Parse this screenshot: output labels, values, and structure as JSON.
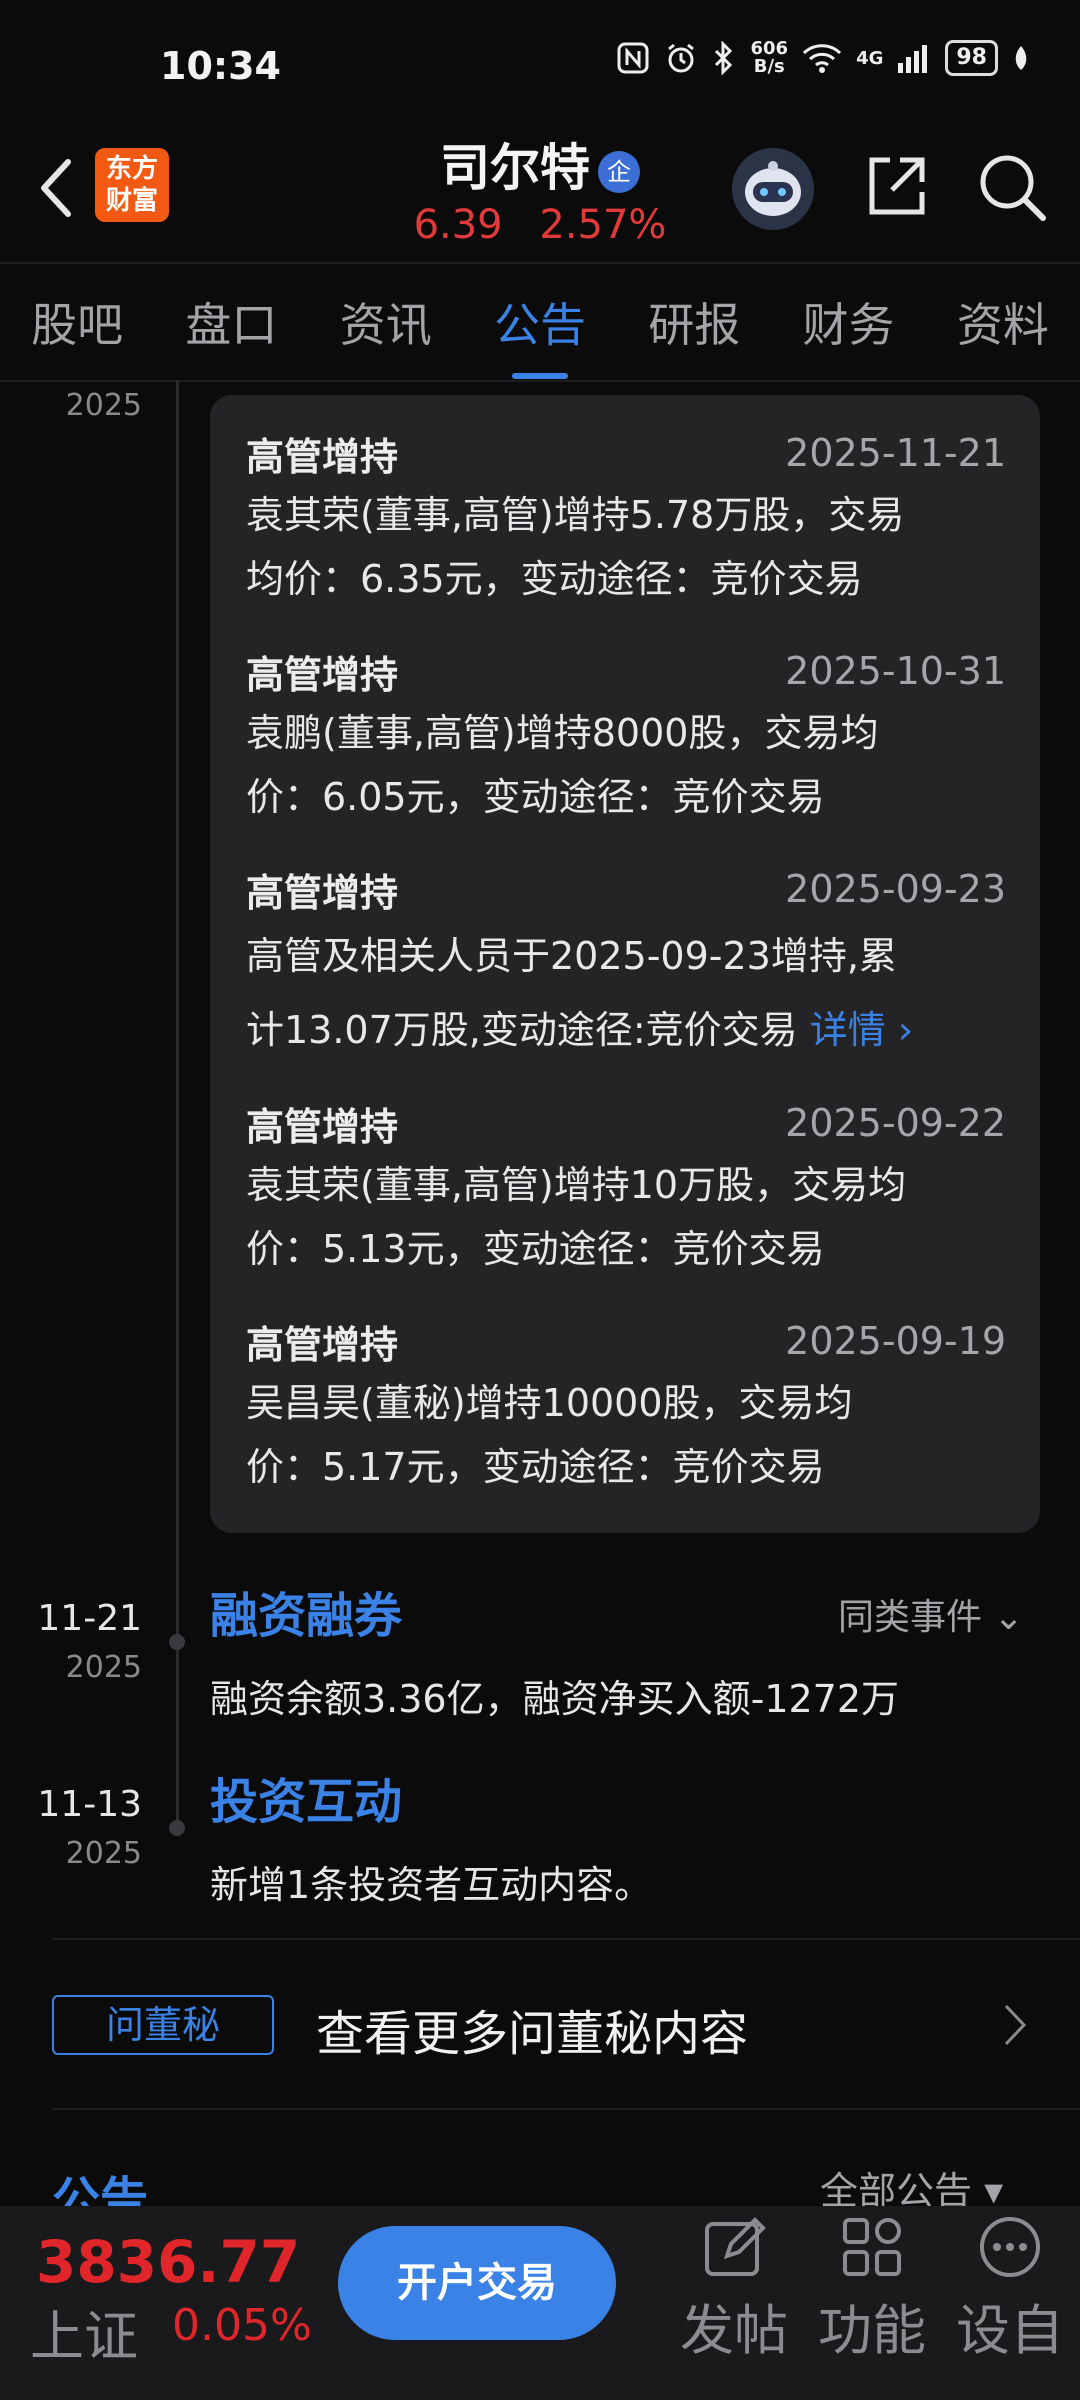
{
  "status": {
    "time": "10:34",
    "net_speed_top": "606",
    "net_speed_bottom": "B/s",
    "signal_label": "4G",
    "battery": "98"
  },
  "header": {
    "logo_line1": "东方",
    "logo_line2": "财富",
    "stock_name": "司尔特",
    "badge": "企",
    "price": "6.39",
    "change_pct": "2.57%"
  },
  "tabs": [
    {
      "label": "股吧"
    },
    {
      "label": "盘口"
    },
    {
      "label": "资讯"
    },
    {
      "label": "公告",
      "active": true
    },
    {
      "label": "研报"
    },
    {
      "label": "财务"
    },
    {
      "label": "资料"
    }
  ],
  "timeline": {
    "top_year": "2025",
    "card_records": [
      {
        "title": "高管增持",
        "date": "2025-11-21",
        "line1": "袁其荣(董事,高管)增持5.78万股，交易",
        "line2": "均价：6.35元，变动途径：竞价交易"
      },
      {
        "title": "高管增持",
        "date": "2025-10-31",
        "line1": "袁鹏(董事,高管)增持8000股，交易均",
        "line2": "价：6.05元，变动途径：竞价交易"
      },
      {
        "title": "高管增持",
        "date": "2025-09-23",
        "line1": "高管及相关人员于2025-09-23增持,累",
        "line2": "计13.07万股,变动途径:竞价交易",
        "link": "详情 ›"
      },
      {
        "title": "高管增持",
        "date": "2025-09-22",
        "line1": "袁其荣(董事,高管)增持10万股，交易均",
        "line2": "价：5.13元，变动途径：竞价交易"
      },
      {
        "title": "高管增持",
        "date": "2025-09-19",
        "line1": "吴昌昊(董秘)增持10000股，交易均",
        "line2": "价：5.17元，变动途径：竞价交易"
      }
    ],
    "events": [
      {
        "date": "11-21",
        "year": "2025",
        "title": "融资融券",
        "body": "融资余额3.36亿，融资净买入额-1272万",
        "action": "同类事件 ⌄"
      },
      {
        "date": "11-13",
        "year": "2025",
        "title": "投资互动",
        "body": "新增1条投资者互动内容。"
      }
    ]
  },
  "dongmi": {
    "badge": "问董秘",
    "text": "查看更多问董秘内容"
  },
  "announcements": {
    "title": "公告",
    "filter": "全部公告 ▾"
  },
  "bottom_bar": {
    "index_value": "3836.77",
    "index_name": "上证",
    "index_pct": "0.05%",
    "open_account": "开户交易",
    "items": [
      {
        "label": "发帖"
      },
      {
        "label": "功能"
      },
      {
        "label": "设自"
      }
    ]
  },
  "colors": {
    "accent": "#3a82e6",
    "up_red": "#e0262a",
    "logo_orange": "#f25a14"
  }
}
